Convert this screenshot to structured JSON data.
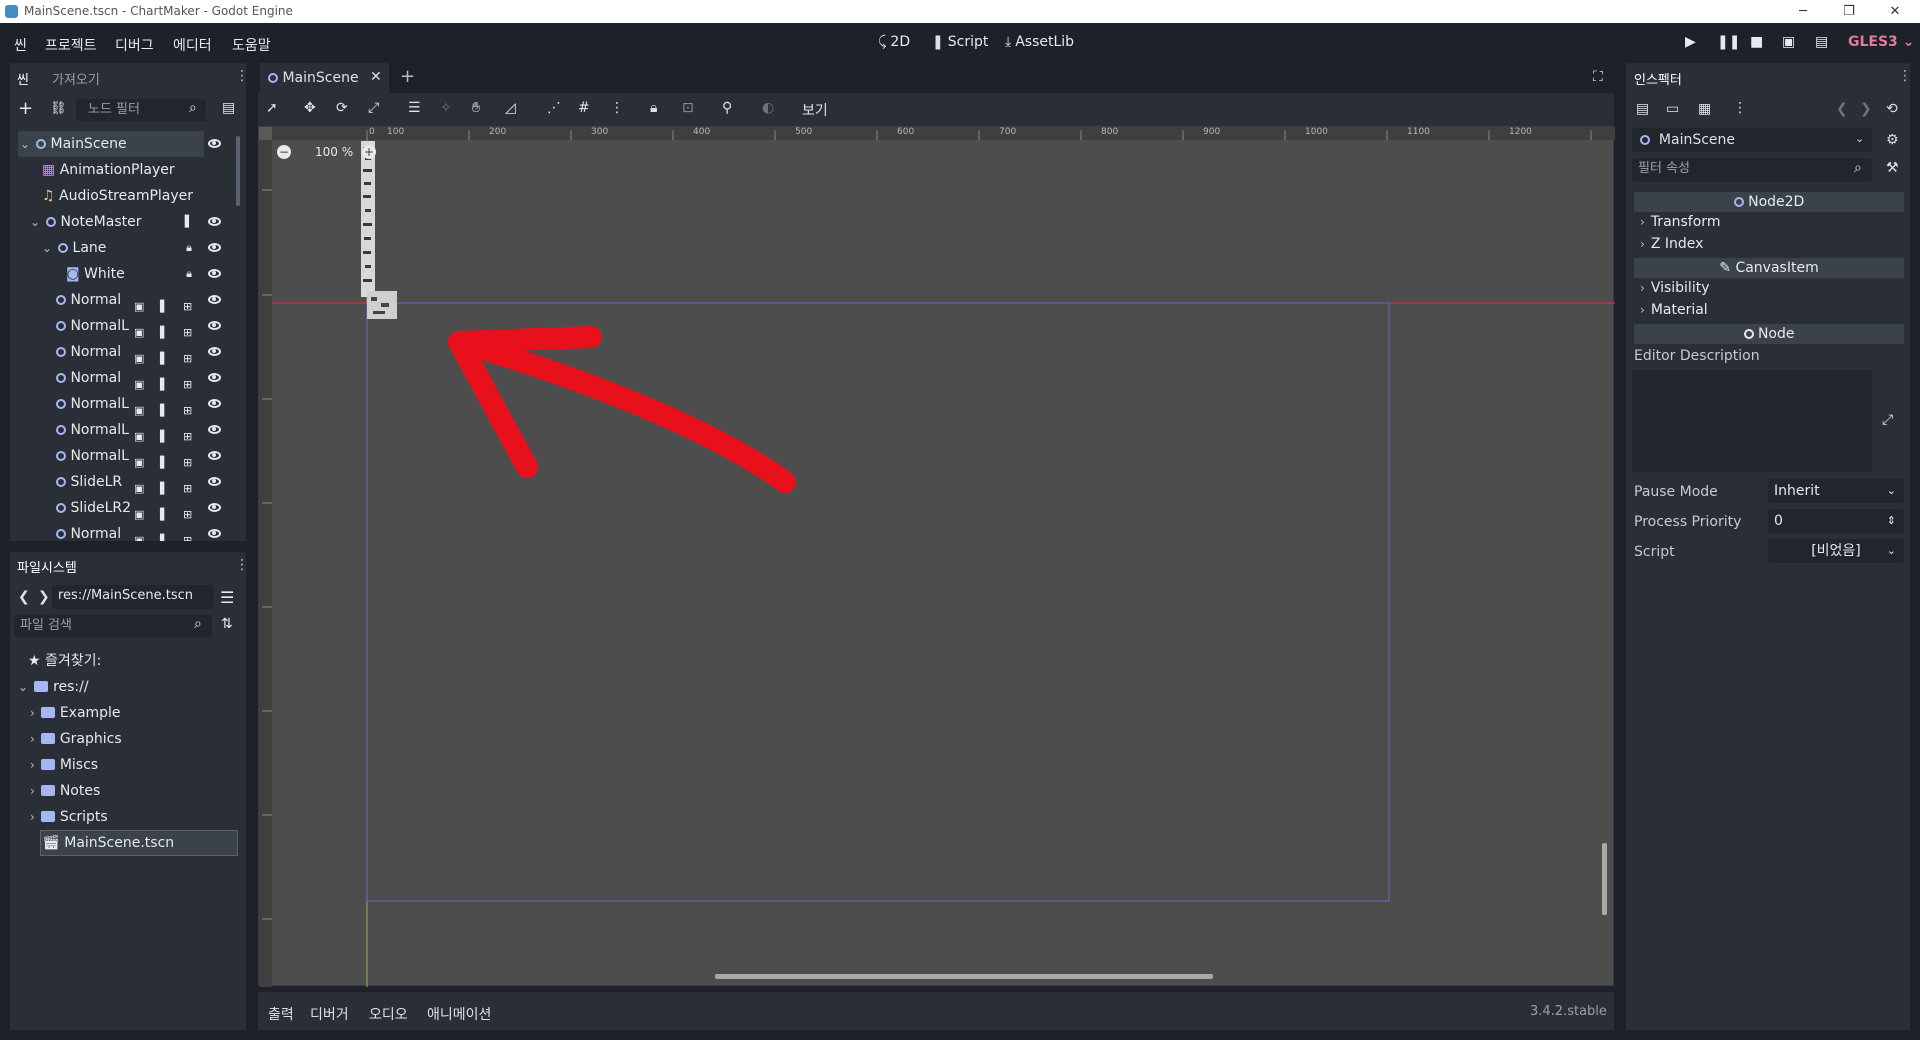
{
  "window": {
    "title": "MainScene.tscn - ChartMaker - Godot Engine",
    "controls": [
      "─",
      "❐",
      "✕"
    ]
  },
  "menu": [
    "씬",
    "프로젝트",
    "디버그",
    "에디터",
    "도움말"
  ],
  "workspaces": [
    {
      "icon": "2d-icon",
      "label": "2D"
    },
    {
      "icon": "script-icon",
      "label": "Script"
    },
    {
      "icon": "assetlib-icon",
      "label": "AssetLib"
    }
  ],
  "renderer": "GLES3",
  "scene_dock": {
    "tabs": [
      "씬",
      "가져오기"
    ],
    "filter_placeholder": "노드 필터",
    "nodes": [
      {
        "name": "MainScene",
        "type": "node2d",
        "depth": 0
      },
      {
        "name": "AnimationPlayer",
        "type": "animation",
        "depth": 1
      },
      {
        "name": "AudioStreamPlayer",
        "type": "audio",
        "depth": 1
      },
      {
        "name": "NoteMaster",
        "type": "node2d",
        "depth": 1
      },
      {
        "name": "Lane",
        "type": "node2d",
        "depth": 2
      },
      {
        "name": "White",
        "type": "sprite",
        "depth": 3
      },
      {
        "name": "Normal",
        "type": "node2d",
        "depth": 2
      },
      {
        "name": "NormalL",
        "type": "node2d",
        "depth": 2
      },
      {
        "name": "Normal",
        "type": "node2d",
        "depth": 2
      },
      {
        "name": "Normal",
        "type": "node2d",
        "depth": 2
      },
      {
        "name": "NormalL",
        "type": "node2d",
        "depth": 2
      },
      {
        "name": "NormalL",
        "type": "node2d",
        "depth": 2
      },
      {
        "name": "NormalL",
        "type": "node2d",
        "depth": 2
      },
      {
        "name": "SlideLR",
        "type": "node2d",
        "depth": 2
      },
      {
        "name": "SlideLR2",
        "type": "node2d",
        "depth": 2
      },
      {
        "name": "Normal",
        "type": "node2d",
        "depth": 2
      }
    ]
  },
  "filesystem": {
    "title": "파일시스템",
    "path": "res://MainScene.tscn",
    "search_placeholder": "파일 검색",
    "favorites": "즐겨찾기:",
    "root": "res://",
    "folders": [
      "Example",
      "Graphics",
      "Miscs",
      "Notes",
      "Scripts"
    ],
    "selected_file": "MainScene.tscn"
  },
  "editor": {
    "tab": "MainScene",
    "zoom": "100 %",
    "view_menu": "보기",
    "ruler_top": [
      "0",
      "100",
      "200",
      "300",
      "400",
      "500",
      "600",
      "700",
      "800",
      "900",
      "1000",
      "1100",
      "1200"
    ],
    "ruler_left": [
      "100",
      "0",
      "100",
      "200",
      "300",
      "400",
      "500",
      "600"
    ]
  },
  "bottom_panel": {
    "tabs": [
      "출력",
      "디버거",
      "오디오",
      "애니메이션"
    ],
    "version": "3.4.2.stable"
  },
  "inspector": {
    "title": "인스펙터",
    "object": "MainScene",
    "filter_placeholder": "필터 속성",
    "sections": {
      "node2d": "Node2D",
      "canvas_item": "CanvasItem",
      "node": "Node"
    },
    "groups": {
      "transform": "Transform",
      "z_index": "Z Index",
      "visibility": "Visibility",
      "material": "Material"
    },
    "editor_description": "Editor Description",
    "props": {
      "pause_mode_label": "Pause Mode",
      "pause_mode_value": "Inherit",
      "priority_label": "Process Priority",
      "priority_value": "0",
      "script_label": "Script",
      "script_value": "[비었음]"
    }
  },
  "colors": {
    "accent": "#a5b7f3",
    "arrow": "#e8111b",
    "renderer": "#e27a9e"
  }
}
